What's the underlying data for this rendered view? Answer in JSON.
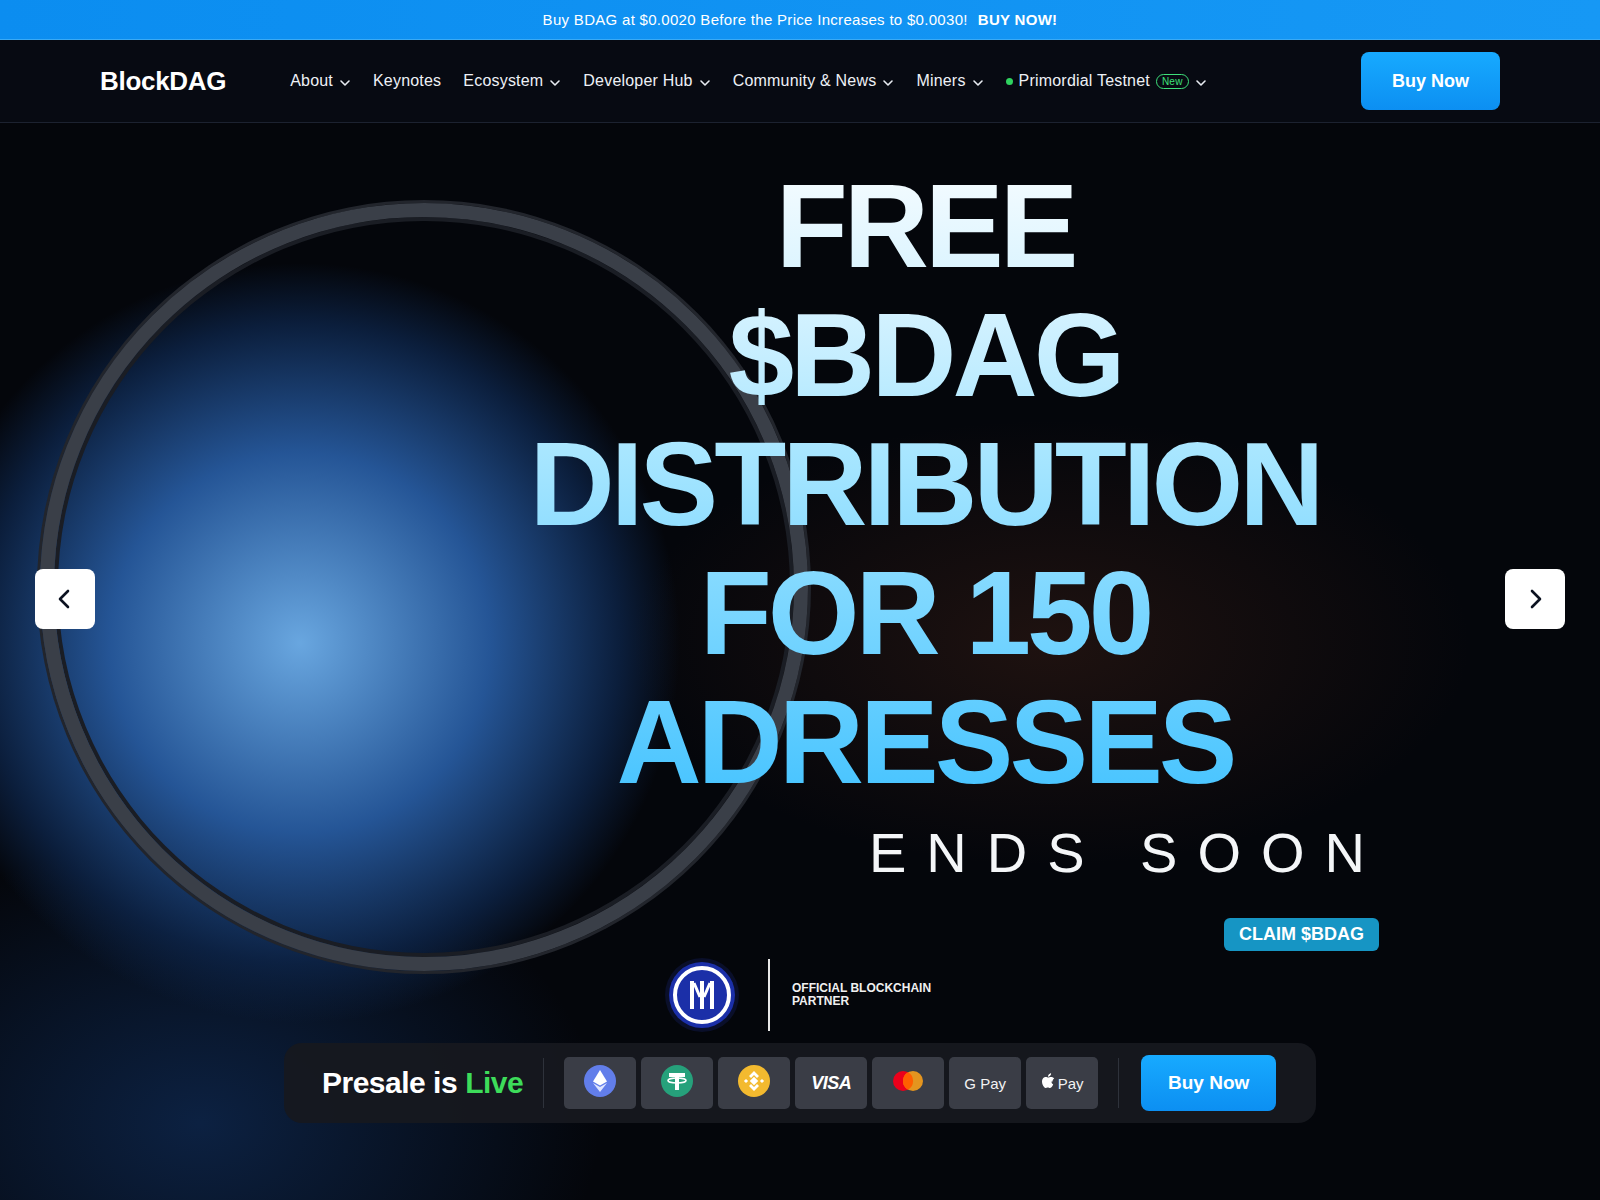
{
  "banner": {
    "text": "Buy BDAG at $0.0020 Before the Price Increases to $0.0030!",
    "link": "BUY NOW!"
  },
  "nav": {
    "logo": "BlockDAG",
    "items": [
      {
        "label": "About",
        "dropdown": true,
        "live": false
      },
      {
        "label": "Keynotes",
        "dropdown": false,
        "live": false
      },
      {
        "label": "Ecosystem",
        "dropdown": true,
        "live": false
      },
      {
        "label": "Developer Hub",
        "dropdown": true,
        "live": false
      },
      {
        "label": "Community & News",
        "dropdown": true,
        "live": false
      },
      {
        "label": "Miners",
        "dropdown": true,
        "live": false
      },
      {
        "label": "Primordial Testnet",
        "dropdown": true,
        "live": true,
        "badge": "New"
      }
    ],
    "cta": "Buy Now"
  },
  "hero": {
    "lines": [
      "FREE",
      "$BDAG",
      "DISTRIBUTION",
      "FOR 150",
      "ADRESSES"
    ],
    "subtitle": "ENDS SOON",
    "claim": "CLAIM $BDAG",
    "partner_lines": [
      "OFFICIAL BLOCKCHAIN",
      "PARTNER"
    ]
  },
  "presale": {
    "label": "Presale is",
    "live": "Live",
    "payments": [
      {
        "kind": "eth"
      },
      {
        "kind": "usdt"
      },
      {
        "kind": "bnb"
      },
      {
        "kind": "visa",
        "label": "VISA"
      },
      {
        "kind": "mastercard"
      },
      {
        "kind": "gpay",
        "label": "G Pay"
      },
      {
        "kind": "applepay",
        "label": "Pay"
      }
    ],
    "cta": "Buy Now"
  }
}
